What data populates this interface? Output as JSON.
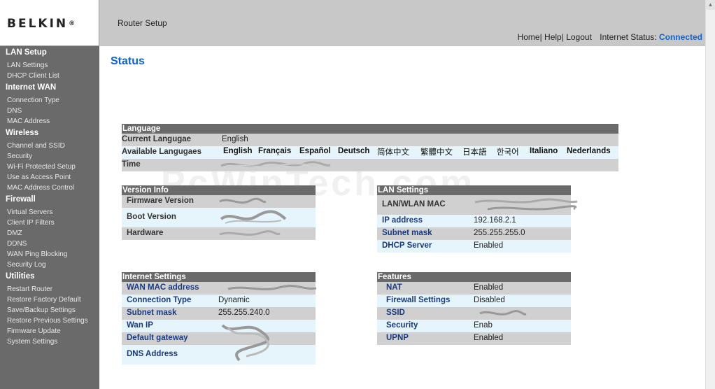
{
  "brand": {
    "name": "BELKIN",
    "reg": "®"
  },
  "header": {
    "title": "Router Setup",
    "links": [
      "Home",
      "Help",
      "Logout"
    ],
    "internet_status_label": "Internet Status:",
    "internet_status_value": "Connected"
  },
  "colors": {
    "accent": "#0b63d8",
    "sidebar": "#6a6a6a",
    "header": "#c8c8c8",
    "row_gray": "#d0d0d0",
    "row_blue": "#e6f5fb"
  },
  "sidebar": {
    "lan_setup": {
      "title": "LAN Setup",
      "items": [
        "LAN Settings",
        "DHCP Client List"
      ]
    },
    "internet_wan": {
      "title": "Internet WAN",
      "items": [
        "Connection Type",
        "DNS",
        "MAC Address"
      ]
    },
    "wireless": {
      "title": "Wireless",
      "items": [
        "Channel and SSID",
        "Security",
        "Wi-Fi Protected Setup",
        "Use as Access Point",
        "MAC Address Control"
      ]
    },
    "firewall": {
      "title": "Firewall",
      "items": [
        "Virtual Servers",
        "Client IP Filters",
        "DMZ",
        "DDNS",
        "WAN Ping Blocking",
        "Security Log"
      ]
    },
    "utilities": {
      "title": "Utilities",
      "items": [
        "Restart Router",
        "Restore Factory Default",
        "Save/Backup Settings",
        "Restore Previous Settings",
        "Firmware Update",
        "System Settings"
      ]
    }
  },
  "main": {
    "title": "Status",
    "watermark": "PcWinTech.com",
    "language": {
      "header": "Language",
      "current_label": "Current Langugae",
      "current_value": "English",
      "available_label": "Available Langugaes",
      "languages": [
        "English",
        "Français",
        "Español",
        "Deutsch",
        "简体中文",
        "繁體中文",
        "日本語",
        "한국어",
        "Italiano",
        "Nederlands"
      ],
      "time_label": "Time"
    },
    "version_info": {
      "header": "Version Info",
      "firmware_label": "Firmware Version",
      "boot_label": "Boot Version",
      "hardware_label": "Hardware"
    },
    "lan_settings": {
      "header": "LAN Settings",
      "mac_label": "LAN/WLAN MAC",
      "ip_label": "IP address",
      "ip_value": "192.168.2.1",
      "subnet_label": "Subnet mask",
      "subnet_value": "255.255.255.0",
      "dhcp_label": "DHCP Server",
      "dhcp_value": "Enabled"
    },
    "internet_settings": {
      "header": "Internet Settings",
      "wan_mac_label": "WAN MAC address",
      "conn_label": "Connection Type",
      "conn_value": "Dynamic",
      "subnet_label": "Subnet mask",
      "subnet_value": "255.255.240.0",
      "wan_ip_label": "Wan IP",
      "gateway_label": "Default gateway",
      "dns_label": "DNS Address"
    },
    "features": {
      "header": "Features",
      "nat_label": "NAT",
      "nat_value": "Enabled",
      "firewall_label": "Firewall Settings",
      "firewall_value": "Disabled",
      "ssid_label": "SSID",
      "security_label": "Security",
      "security_value": "Enab",
      "upnp_label": "UPNP",
      "upnp_value": "Enabled"
    }
  }
}
